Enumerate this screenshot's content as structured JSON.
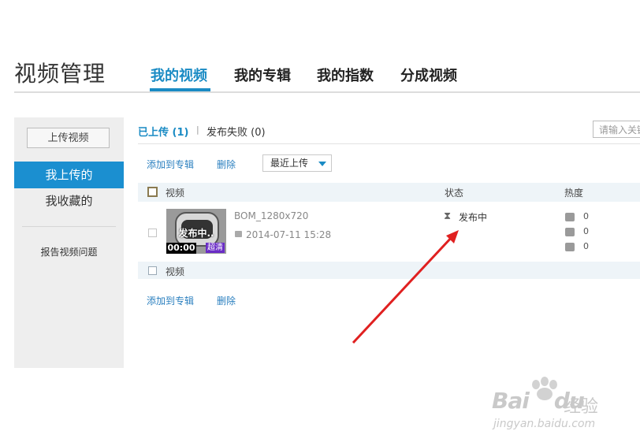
{
  "header": {
    "title": "视频管理",
    "tabs": [
      {
        "label": "我的视频",
        "active": true
      },
      {
        "label": "我的专辑"
      },
      {
        "label": "我的指数"
      },
      {
        "label": "分成视频"
      }
    ]
  },
  "sidebar": {
    "upload_button": "上传视频",
    "items": [
      {
        "label": "我上传的",
        "active": true
      },
      {
        "label": "我收藏的"
      }
    ],
    "report_link": "报告视频问题"
  },
  "subtabs": {
    "uploaded": "已上传 (1)",
    "separator": "|",
    "failed": "发布失败 (0)",
    "search_placeholder": "请输入关键"
  },
  "toolbar": {
    "add_to_album": "添加到专辑",
    "delete": "删除",
    "sort_selected": "最近上传"
  },
  "table": {
    "headers": {
      "video": "视频",
      "status": "状态",
      "heat": "热度"
    },
    "rows": [
      {
        "thumb_text": "发布中..",
        "duration": "00:00",
        "quality": "超清",
        "title": "BOM_1280x720",
        "date": "2014-07-11 15:28",
        "status": "发布中",
        "plays": "0",
        "comments": "0",
        "shares": "0"
      }
    ],
    "footer_label": "视频"
  },
  "bottom_toolbar": {
    "add_to_album": "添加到专辑",
    "delete": "删除"
  },
  "watermark": {
    "brand": "Bai",
    "brand2": "du",
    "cn": "经验",
    "url": "jingyan.baidu.com"
  },
  "colors": {
    "accent": "#1a8bc4",
    "sidebar_active": "#1b8fd0",
    "arrow": "#e02020"
  }
}
